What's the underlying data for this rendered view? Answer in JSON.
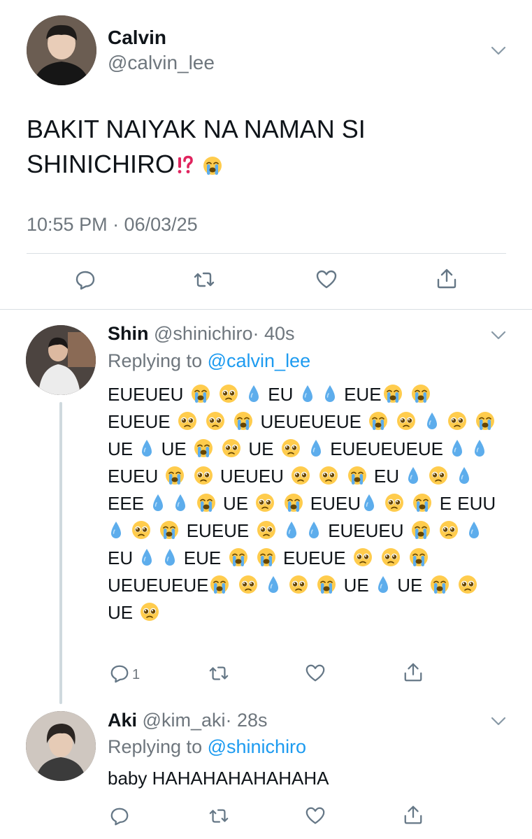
{
  "main_tweet": {
    "author_name": "Calvin",
    "author_handle": "@calvin_lee",
    "text_line1": "BAKIT NAIYAK NA NAMAN SI",
    "text_line2": "SHINICHIRO⁉️ 😭",
    "timestamp": "10:55 PM · 06/03/25"
  },
  "reply_1": {
    "author_name": "Shin",
    "author_handle": "@shinichiro",
    "time": "· 40s",
    "replying_prefix": "Replying to",
    "replying_to": "@calvin_lee",
    "text": "EUEUEU 😭 🥺 💧 EU 💧 💧 EUE😭 😭 EUEUE 🥺 🥺 😭 UEUEUEUE 😭 🥺 💧 🥺 😭 UE 💧 UE 😭 🥺 UE 🥺 💧 EUEUEUEUE 💧 💧 EUEU 😭 🥺 UEUEU 🥺 🥺 😭 EU 💧 🥺 💧 EEE 💧 💧 😭 UE 🥺 😭 EUEU💧 🥺 😭 E EUU💧 🥺 😭 EUEUE 🥺 💧 💧 EUEUEU 😭 🥺 💧 EU 💧 💧 EUE 😭 😭 EUEUE 🥺 🥺 😭 UEUEUEUE😭 🥺 💧 🥺 😭 UE 💧 UE 😭 🥺 UE 🥺",
    "reply_count": "1"
  },
  "reply_2": {
    "author_name": "Aki",
    "author_handle": "@kim_aki",
    "time": "· 28s",
    "replying_prefix": "Replying to",
    "replying_to": "@shinichiro",
    "text": "baby HAHAHAHAHAHAHA"
  },
  "icons": [
    "chevron-down-icon",
    "reply-icon",
    "retweet-icon",
    "like-icon",
    "share-icon"
  ],
  "colors": {
    "link": "#1d9bf0",
    "muted": "#6e767d",
    "thread_line": "#cfd9de",
    "alarm_red": "#e0245e"
  }
}
